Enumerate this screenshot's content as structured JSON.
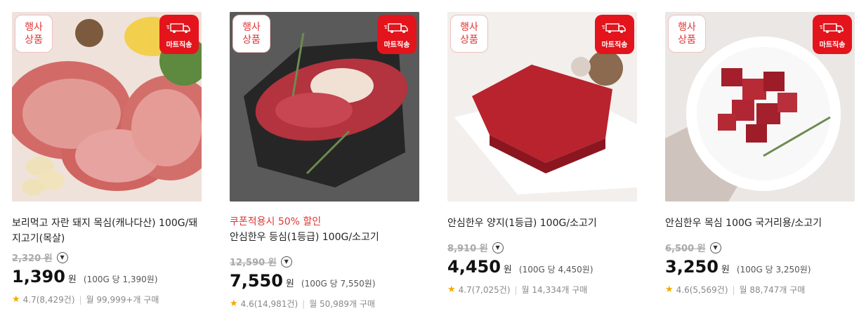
{
  "products": [
    {
      "name": "보리먹고 자란 돼지 목심(캐나다산) 100G/돼지고기(목살)",
      "coupon": "",
      "original_price": "2,320 원",
      "price": "1,390",
      "won": "원",
      "unit_price": "(100G 당 1,390원)",
      "rating": "4.7(8,429건)",
      "sales": "월 99,999+개 구매",
      "event_badge": "행사\n상품",
      "mart_badge": "마트직송",
      "colors": {
        "bg1": "#e7dbd0",
        "bg2": "#a7473f"
      }
    },
    {
      "name": "안심한우 등심(1등급) 100G/소고기",
      "coupon": "쿠폰적용시 50% 할인",
      "original_price": "12,590 원",
      "price": "7,550",
      "won": "원",
      "unit_price": "(100G 당 7,550원)",
      "rating": "4.6(14,981건)",
      "sales": "월 50,989개 구매",
      "event_badge": "행사\n상품",
      "mart_badge": "마트직송",
      "colors": {
        "bg1": "#5c5c5c",
        "bg2": "#2d2d2d"
      }
    },
    {
      "name": "안심한우 양지(1등급) 100G/소고기",
      "coupon": "",
      "original_price": "8,910 원",
      "price": "4,450",
      "won": "원",
      "unit_price": "(100G 당 4,450원)",
      "rating": "4.7(7,025건)",
      "sales": "월 14,334개 구매",
      "event_badge": "행사\n상품",
      "mart_badge": "마트직송",
      "colors": {
        "bg1": "#f4f1ef",
        "bg2": "#e8e3df"
      }
    },
    {
      "name": "안심한우 목심 100G 국거리용/소고기",
      "coupon": "",
      "original_price": "6,500 원",
      "price": "3,250",
      "won": "원",
      "unit_price": "(100G 당 3,250원)",
      "rating": "4.6(5,569건)",
      "sales": "월 88,747개 구매",
      "event_badge": "행사\n상품",
      "mart_badge": "마트직송",
      "colors": {
        "bg1": "#efeceb",
        "bg2": "#d9d2cf"
      }
    }
  ]
}
